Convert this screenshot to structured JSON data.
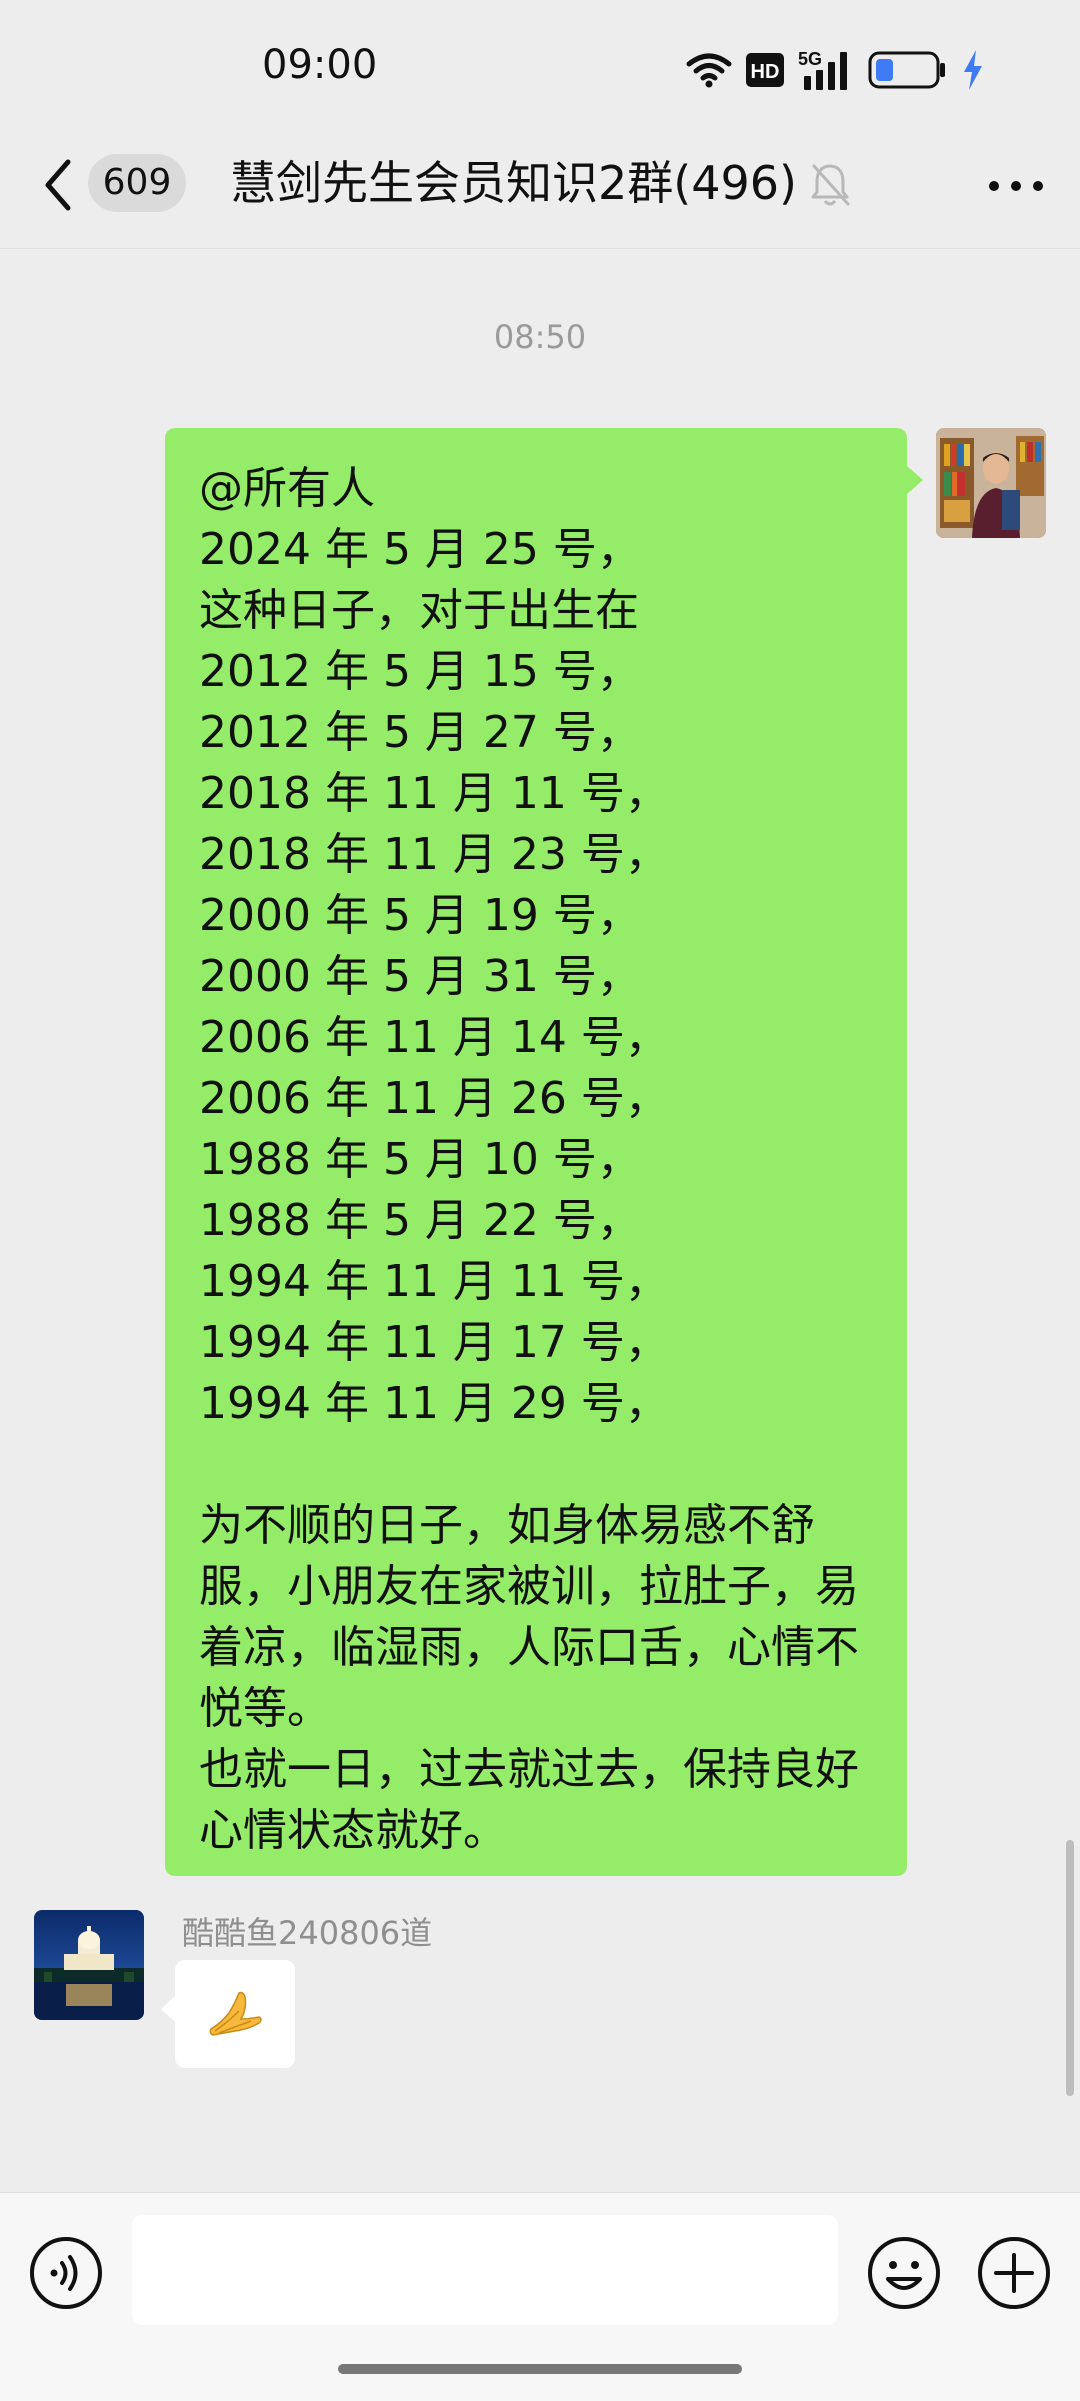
{
  "status_bar": {
    "time": "09:00",
    "hd_badge": "HD",
    "network_label": "5G",
    "icons": [
      "wifi-icon",
      "hd-icon",
      "signal-5g-icon",
      "battery-icon",
      "charging-icon"
    ],
    "battery_level_fraction": 0.3
  },
  "header": {
    "unread_count": "609",
    "title": "慧剑先生会员知识2群(496)",
    "icons": [
      "back-icon",
      "mute-bell-icon",
      "more-icon"
    ]
  },
  "chat": {
    "timestamp": "08:50",
    "messages": [
      {
        "from": "self",
        "lines": [
          "@所有人",
          "2024 年 5 月 25 号，",
          "这种日子，对于出生在",
          "2012 年 5 月 15 号，",
          "2012 年 5 月 27 号，",
          "2018 年 11 月 11 号，",
          "2018 年 11 月 23 号，",
          "2000 年 5 月 19 号，",
          "2000 年 5 月 31 号，",
          "2006 年 11 月 14 号，",
          "2006 年 11 月 26 号，",
          "1988 年 5 月 10 号，",
          "1988 年 5 月 22 号，",
          "1994 年 11 月 11 号，",
          "1994 年 11 月 17 号，",
          "1994 年 11 月 29 号，",
          "",
          "为不顺的日子，如身体易感不舒",
          "服，小朋友在家被训，拉肚子，易",
          "着凉，临湿雨，人际口舌，心情不",
          "悦等。",
          "也就一日，过去就过去，保持良好",
          "心情状态就好。"
        ]
      },
      {
        "from": "other",
        "sender_name": "酷酷鱼240806道",
        "content_icon": "folded-hands-icon"
      }
    ]
  },
  "input_bar": {
    "value": "",
    "icons": [
      "voice-icon",
      "emoji-icon",
      "plus-icon"
    ]
  },
  "colors": {
    "background": "#ededed",
    "self_bubble": "#95ec69",
    "other_bubble": "#ffffff",
    "timestamp_text": "#9a9a9a",
    "sender_name_text": "#8f8f8f",
    "battery_fill": "#3f7bf5"
  }
}
